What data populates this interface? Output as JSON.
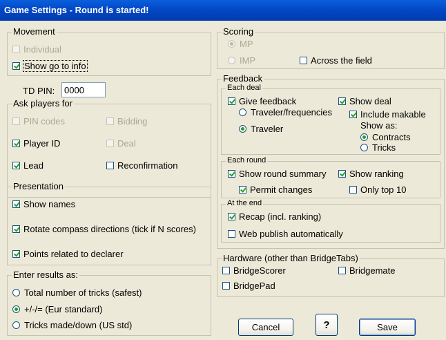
{
  "window": {
    "title": "Game Settings - Round is started!"
  },
  "movement": {
    "label": "Movement",
    "individual": "Individual",
    "show_go_to_info": "Show go to info"
  },
  "td_pin": {
    "label": "TD PIN:",
    "value": "0000"
  },
  "ask": {
    "label": "Ask players for",
    "pin_codes": "PIN codes",
    "bidding": "Bidding",
    "player_id": "Player ID",
    "deal": "Deal",
    "lead": "Lead",
    "reconfirmation": "Reconfirmation"
  },
  "presentation": {
    "label": "Presentation",
    "show_names": "Show names",
    "rotate": "Rotate compass directions (tick if N scores)",
    "points": "Points related to declarer"
  },
  "results": {
    "label": "Enter results as:",
    "total": "Total number of tricks (safest)",
    "eur": "+/-/= (Eur standard)",
    "us": "Tricks made/down (US std)"
  },
  "scoring": {
    "label": "Scoring",
    "mp": "MP",
    "imp": "IMP",
    "across": "Across the field"
  },
  "feedback": {
    "label": "Feedback",
    "each_deal": {
      "label": "Each deal",
      "give_feedback": "Give feedback",
      "show_deal": "Show deal",
      "traveler_freq": "Traveler/frequencies",
      "include_makable": "Include makable",
      "traveler": "Traveler",
      "show_as": "Show as:",
      "contracts": "Contracts",
      "tricks": "Tricks"
    },
    "each_round": {
      "label": "Each round",
      "show_round_summary": "Show round summary",
      "show_ranking": "Show ranking",
      "permit_changes": "Permit changes",
      "only_top": "Only top 10"
    },
    "at_end": {
      "label": "At the end",
      "recap": "Recap (incl. ranking)",
      "web_publish": "Web publish automatically"
    }
  },
  "hardware": {
    "label": "Hardware (other than BridgeTabs)",
    "bridgescorer": "BridgeScorer",
    "bridgemate": "Bridgemate",
    "bridgepad": "BridgePad"
  },
  "buttons": {
    "cancel": "Cancel",
    "help": "?",
    "save": "Save"
  }
}
